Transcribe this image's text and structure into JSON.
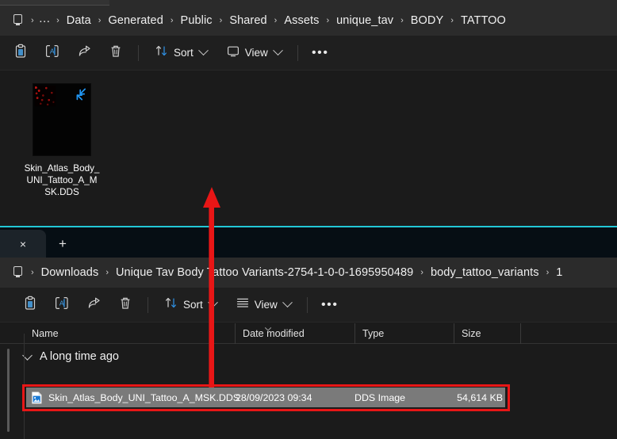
{
  "window_top": {
    "breadcrumb": {
      "home_icon": "monitor-icon",
      "overflow": "…",
      "items": [
        "Data",
        "Generated",
        "Public",
        "Shared",
        "Assets",
        "unique_tav",
        "BODY",
        "TATTOO"
      ],
      "separator": "›"
    },
    "toolbar": {
      "paste_icon": "clipboard-icon",
      "rename_icon": "rename-icon",
      "share_icon": "share-icon",
      "delete_icon": "trash-icon",
      "sort_icon": "sort-arrows-icon",
      "sort_label": "Sort",
      "view_icon": "monitor-view-icon",
      "view_label": "View",
      "more_label": "•••"
    },
    "files": [
      {
        "name_line1": "Skin_Atlas_Body_",
        "name_line2": "UNI_Tattoo_A_M",
        "name_line3": "SK.DDS",
        "full_name": "Skin_Atlas_Body_UNI_Tattoo_A_MSK.DDS",
        "overlay_icon": "collapse-arrows-icon"
      }
    ]
  },
  "window_bottom": {
    "accent_color": "#22c7d6",
    "tabs": {
      "close_label": "×",
      "new_tab_label": "+"
    },
    "breadcrumb": {
      "home_icon": "monitor-icon",
      "items": [
        "Downloads",
        "Unique Tav Body Tattoo Variants-2754-1-0-0-1695950489",
        "body_tattoo_variants",
        "1"
      ],
      "separator": "›"
    },
    "toolbar": {
      "paste_icon": "clipboard-icon",
      "rename_icon": "rename-icon",
      "share_icon": "share-icon",
      "delete_icon": "trash-icon",
      "sort_icon": "sort-arrows-icon",
      "sort_label": "Sort",
      "view_icon": "list-view-icon",
      "view_label": "View",
      "more_label": "•••"
    },
    "columns": [
      "Name",
      "Date modified",
      "Type",
      "Size"
    ],
    "group_header": "A long time ago",
    "rows": [
      {
        "icon": "dds-image-file-icon",
        "name": "Skin_Atlas_Body_UNI_Tattoo_A_MSK.DDS",
        "date_modified": "28/09/2023 09:34",
        "type": "DDS Image",
        "size": "54,614 KB",
        "selected": true
      }
    ]
  },
  "annotations": {
    "arrow_color": "#e81616",
    "highlight_color": "#e81616"
  }
}
